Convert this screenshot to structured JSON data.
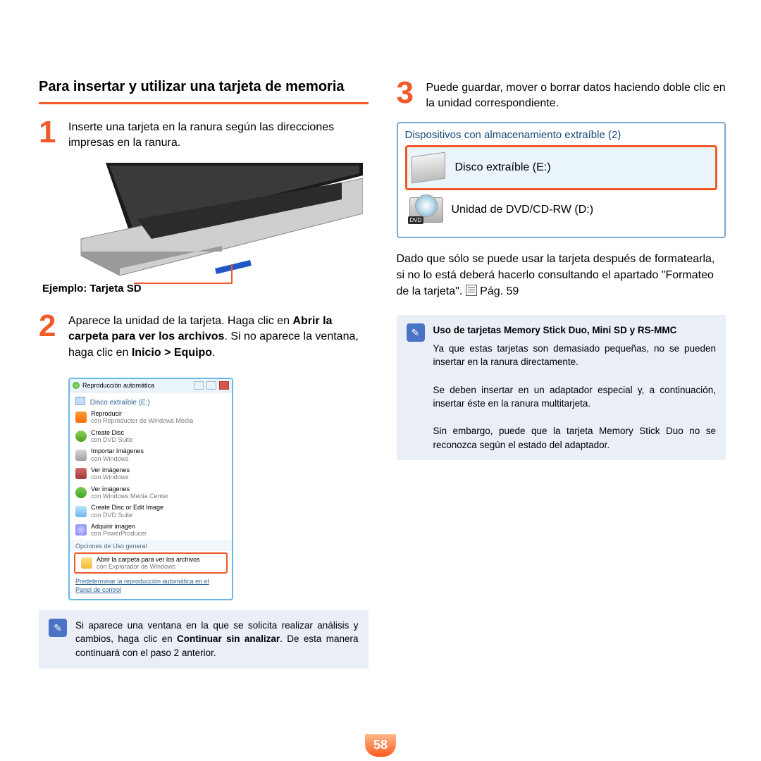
{
  "left": {
    "title": "Para insertar y utilizar una tarjeta de memoria",
    "step1_num": "1",
    "step1_text": "Inserte una tarjeta en la ranura según las direcciones impresas en la ranura.",
    "example_label": "Ejemplo: Tarjeta SD",
    "step2_num": "2",
    "step2_text_before_bold1": "Aparece la unidad de la tarjeta. Haga clic en ",
    "step2_bold1": "Abrir la carpeta para ver los archivos",
    "step2_mid": ". Si no aparece la ventana, haga clic en ",
    "step2_bold2": "Inicio > Equipo",
    "step2_end": ".",
    "autoplay": {
      "window_title": "Reproducción automática",
      "drive": "Disco extraíble (E:)",
      "items": [
        {
          "title": "Reproducir",
          "sub": "con Reproductor de Windows Media"
        },
        {
          "title": "Create Disc",
          "sub": "con DVD Suite"
        },
        {
          "title": "Importar imágenes",
          "sub": "con Windows"
        },
        {
          "title": "Ver imágenes",
          "sub": "con Windows"
        },
        {
          "title": "Ver imágenes",
          "sub": "con Windows Media Center"
        },
        {
          "title": "Create Disc or Edit Image",
          "sub": "con DVD Suite"
        },
        {
          "title": "Adquirir imagen",
          "sub": "con PowerProducer"
        }
      ],
      "general_label": "Opciones de Uso general",
      "open_folder_title": "Abrir la carpeta para ver los archivos",
      "open_folder_sub": "con Explorador de Windows",
      "footer1": "Predeterminar la reproducción automática en el",
      "footer2": "Panel de control"
    },
    "note": {
      "line1_before": "Si aparece una ventana en la que se solicita realizar análisis y cambios, haga clic en ",
      "line1_bold": "Continuar sin analizar",
      "line1_after": ". De esta manera continuará con el paso 2 anterior."
    }
  },
  "right": {
    "step3_num": "3",
    "step3_text": "Puede guardar, mover o borrar datos haciendo doble clic en la unidad correspondente.",
    "step3_text_fixed": "Puede guardar, mover o borrar datos haciendo doble clic en la unidad correspondiente.",
    "devices": {
      "title": "Dispositivos con almacenamiento extraíble (2)",
      "removable": "Disco extraíble (E:)",
      "dvd": "Unidad de DVD/CD-RW (D:)",
      "dvd_badge": "DVD"
    },
    "after_box_text": "Dado que sólo se puede usar la tarjeta después de formatearla, si no lo está deberá hacerlo consultando el apartado \"Formateo de la tarjeta\". ",
    "page_ref": "Pág. 59",
    "note": {
      "title": "Uso de tarjetas Memory Stick Duo, Mini SD y RS-MMC",
      "p1": "Ya que estas tarjetas son demasiado pequeñas, no se pueden insertar en la ranura directamente.",
      "p2": "Se deben insertar en un adaptador especial y, a continuación, insertar éste en la ranura multitarjeta.",
      "p3": "Sin embargo, puede que la tarjeta Memory Stick Duo no se reconozca según el estado del adaptador."
    }
  },
  "page_number": "58"
}
